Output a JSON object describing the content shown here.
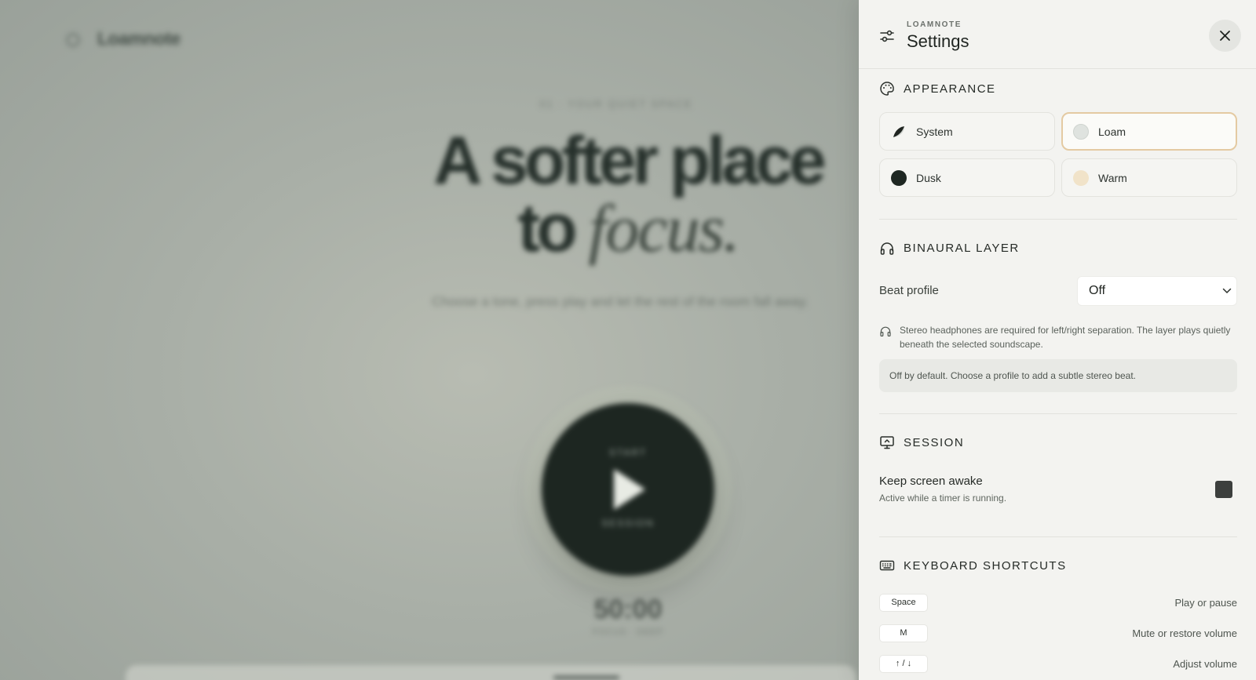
{
  "backdrop": {
    "app_name": "Loamnote",
    "kicker": "01 · YOUR QUIET SPACE",
    "headline_line1": "A softer place",
    "headline_line2_plain": "to",
    "headline_line2_italic": "focus.",
    "subtitle": "Choose a tone, press play and let the rest of the room fall away.",
    "play_label_top": "START",
    "play_label_bottom": "SESSION",
    "timer": "50:00",
    "timer_sub": "FOCUS · DEEP"
  },
  "panel": {
    "kicker": "LOAMNOTE",
    "title": "Settings",
    "appearance": {
      "title": "APPEARANCE",
      "options": [
        {
          "label": "System",
          "swatch": "split",
          "selected": false
        },
        {
          "label": "Loam",
          "swatch": "#dfe3df",
          "selected": true
        },
        {
          "label": "Dusk",
          "swatch": "#1e2722",
          "selected": false
        },
        {
          "label": "Warm",
          "swatch": "#f1e3c9",
          "selected": false
        }
      ]
    },
    "binaural": {
      "title": "BINAURAL LAYER",
      "field_label": "Beat profile",
      "selected_value": "Off",
      "note": "Stereo headphones are required for left/right separation. The layer plays quietly beneath the selected soundscape.",
      "info": "Off by default. Choose a profile to add a subtle stereo beat."
    },
    "session": {
      "title": "SESSION",
      "toggle_label": "Keep screen awake",
      "toggle_sub": "Active while a timer is running.",
      "toggle_on": false
    },
    "shortcuts": {
      "title": "KEYBOARD SHORTCUTS",
      "items": [
        {
          "key": "Space",
          "desc": "Play or pause"
        },
        {
          "key": "M",
          "desc": "Mute or restore volume"
        },
        {
          "key": "↑ / ↓",
          "desc": "Adjust volume"
        }
      ]
    }
  },
  "colors": {
    "accent_border": "#e4caa2",
    "panel_bg": "#f3f3f0",
    "text_primary": "#1f2420"
  }
}
